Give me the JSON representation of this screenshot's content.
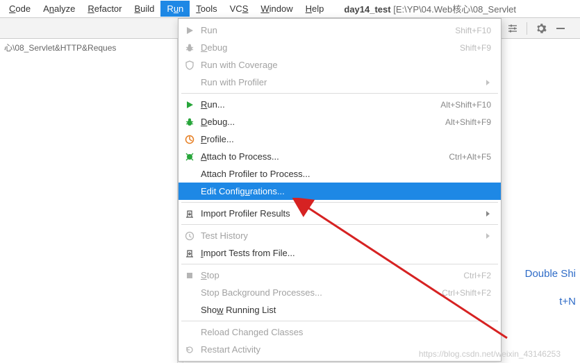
{
  "menubar": {
    "items": [
      {
        "label": "Code",
        "mn": "C"
      },
      {
        "label": "Analyze",
        "mn": "n"
      },
      {
        "label": "Refactor",
        "mn": "R"
      },
      {
        "label": "Build",
        "mn": "B"
      },
      {
        "label": "Run",
        "mn": "u",
        "open": true
      },
      {
        "label": "Tools",
        "mn": "T"
      },
      {
        "label": "VCS",
        "mn": "S"
      },
      {
        "label": "Window",
        "mn": "W"
      },
      {
        "label": "Help",
        "mn": "H"
      }
    ],
    "project_name": "day14_test",
    "project_path": "[E:\\YP\\04.Web核心\\08_Servlet"
  },
  "breadcrumb": "心\\08_Servlet&HTTP&Reques",
  "dropdown": {
    "groups": [
      [
        {
          "icon": "play-gray",
          "label": "Run",
          "shortcut": "Shift+F10",
          "disabled": true
        },
        {
          "icon": "bug-gray",
          "label": "Debug",
          "shortcut": "Shift+F9",
          "disabled": true,
          "mn": "D"
        },
        {
          "icon": "shield-gray",
          "label": "Run with Coverage",
          "disabled": true
        },
        {
          "icon": "blank",
          "label": "Run with Profiler",
          "disabled": true,
          "submenu": true
        }
      ],
      [
        {
          "icon": "play-green",
          "label": "Run...",
          "shortcut": "Alt+Shift+F10",
          "mn": "R"
        },
        {
          "icon": "bug-green",
          "label": "Debug...",
          "shortcut": "Alt+Shift+F9",
          "mn": "D"
        },
        {
          "icon": "profile",
          "label": "Profile...",
          "mn": "P"
        },
        {
          "icon": "attach",
          "label": "Attach to Process...",
          "shortcut": "Ctrl+Alt+F5",
          "mn": "A"
        },
        {
          "icon": "blank",
          "label": "Attach Profiler to Process..."
        },
        {
          "icon": "blank",
          "label": "Edit Configurations...",
          "highlight": true,
          "mn": "u"
        }
      ],
      [
        {
          "icon": "import",
          "label": "Import Profiler Results",
          "submenu": true
        }
      ],
      [
        {
          "icon": "clock-gray",
          "label": "Test History",
          "disabled": true,
          "submenu": true
        },
        {
          "icon": "import",
          "label": "Import Tests from File...",
          "mn": "I"
        }
      ],
      [
        {
          "icon": "stop-gray",
          "label": "Stop",
          "shortcut": "Ctrl+F2",
          "disabled": true,
          "mn": "S"
        },
        {
          "icon": "blank",
          "label": "Stop Background Processes...",
          "shortcut": "Ctrl+Shift+F2",
          "disabled": true
        },
        {
          "icon": "blank",
          "label": "Show Running List",
          "mn": "w"
        }
      ],
      [
        {
          "icon": "blank",
          "label": "Reload Changed Classes",
          "disabled": true
        },
        {
          "icon": "restart-gray",
          "label": "Restart Activity",
          "disabled": true
        }
      ]
    ]
  },
  "bgtext1": "Double Shi",
  "bgtext2": "t+N",
  "watermark": "https://blog.csdn.net/weixin_43146253"
}
